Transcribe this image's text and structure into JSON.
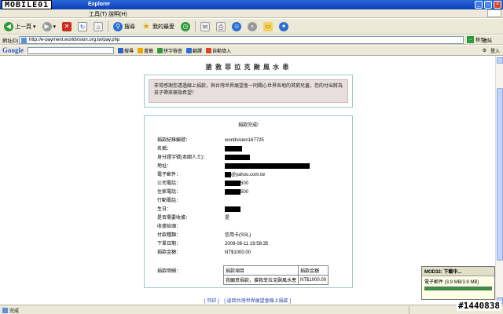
{
  "titlebar": {
    "logo": "MOBILE01",
    "title": "Explorer",
    "controls": [
      "_",
      "□",
      "×"
    ]
  },
  "menu": {
    "items": [
      "工具(T)",
      "說明(H)"
    ]
  },
  "toolbar": {
    "back": "上一頁",
    "search": "搜尋",
    "favorites": "我的最愛"
  },
  "address": {
    "label": "網址(D)",
    "url": "http://e-payment.worldvision.org.tw/pay.php",
    "go": "移至",
    "links": "連結"
  },
  "google_toolbar": {
    "logo": "Google",
    "search_btn": "搜尋",
    "btn2": "書籤",
    "spell": "拼字檢查",
    "translate": "翻譯",
    "autofill": "自動填入",
    "login": "登入"
  },
  "page": {
    "title": "搶 救 菲 拉 克 颱 風 水 患",
    "notice": "非常感謝您透過線上捐款，與台灣世界展望會一同關心世界各地的貧窮兒童，您的付出將為孩子帶來無限希望！",
    "panel_title": "捐款完成!",
    "fields": [
      {
        "label": "捐款紀錄編號：",
        "value": "worldvision167725"
      },
      {
        "label": "名稱：",
        "value": ""
      },
      {
        "label": "身分證字號(本國人士)：",
        "value": ""
      },
      {
        "label": "地址：",
        "value": ""
      },
      {
        "label": "電子郵件：",
        "value": "@yahoo.com.tw"
      },
      {
        "label": "公司電話：",
        "value": "500"
      },
      {
        "label": "住家電話：",
        "value": "500"
      },
      {
        "label": "行動電話：",
        "value": ""
      },
      {
        "label": "生日：",
        "value": ""
      },
      {
        "label": "是否需要收據：",
        "value": "是"
      },
      {
        "label": "收據抬頭：",
        "value": ""
      },
      {
        "label": "付款種類：",
        "value": "信用卡(SSL)"
      },
      {
        "label": "下單日期：",
        "value": "2009-08-11 19:58:35"
      },
      {
        "label": "捐款金額：",
        "value": "NT$1000.00"
      }
    ],
    "detail_label": "捐款明細：",
    "detail_headers": [
      "捐款項目",
      "捐款金額"
    ],
    "detail_rows": [
      [
        "我願意捐款，搶救菲拉克颱風水患",
        "NT$1000.00"
      ]
    ],
    "footer": {
      "print": "[ 列印 ]",
      "back": "[ 返回台灣世界展望會線上捐款 ]"
    }
  },
  "popup": {
    "title": "MOD32: 下載中...",
    "line": "電子郵件 (3.9 MB/3.9 MB)",
    "progress": 1.0
  },
  "status": {
    "text": "完成"
  },
  "watermark": "#1440838"
}
